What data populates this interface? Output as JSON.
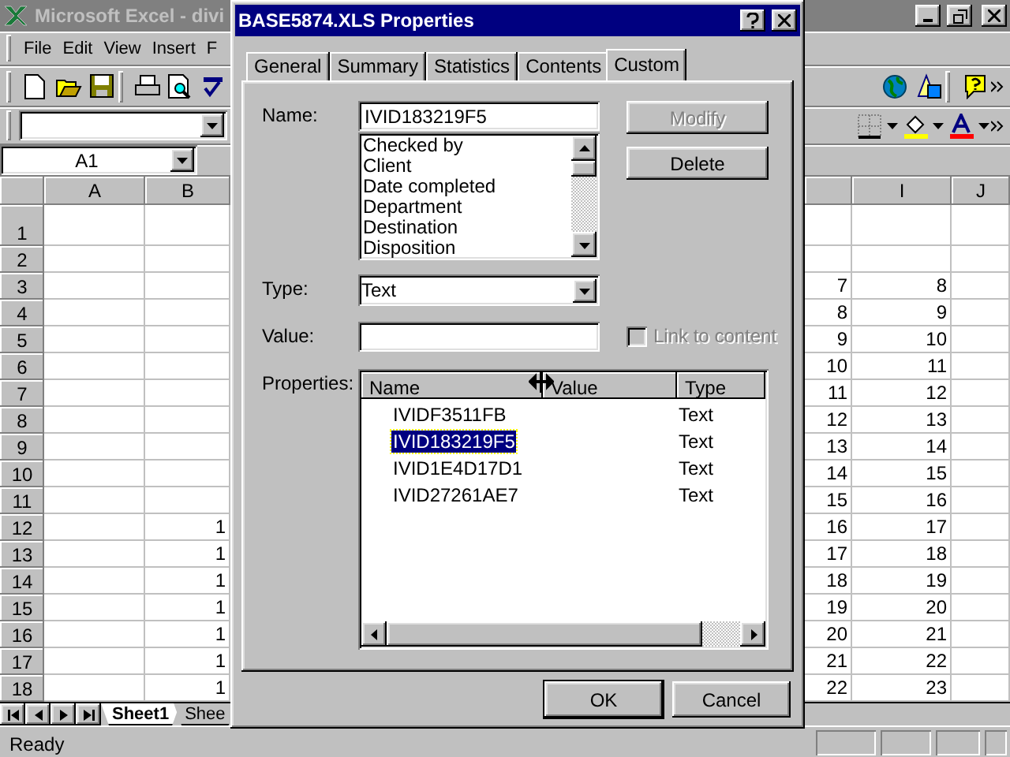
{
  "excel": {
    "title": "Microsoft Excel - divi",
    "menu": [
      "File",
      "Edit",
      "View",
      "Insert",
      "F"
    ],
    "name_box": "A1",
    "headers_left": [
      "A",
      "B"
    ],
    "headers_right": [
      "I",
      "J"
    ],
    "rows": [
      {
        "label": "1"
      },
      {
        "label": "2"
      },
      {
        "label": "3",
        "h": "7",
        "i": "8"
      },
      {
        "label": "4",
        "h": "8",
        "i": "9"
      },
      {
        "label": "5",
        "h": "9",
        "i": "10"
      },
      {
        "label": "6",
        "h": "10",
        "i": "11"
      },
      {
        "label": "7",
        "h": "11",
        "i": "12"
      },
      {
        "label": "8",
        "h": "12",
        "i": "13"
      },
      {
        "label": "9",
        "h": "13",
        "i": "14"
      },
      {
        "label": "10",
        "h": "14",
        "i": "15"
      },
      {
        "label": "11",
        "h": "15",
        "i": "16"
      },
      {
        "label": "12",
        "b": "1",
        "h": "16",
        "i": "17"
      },
      {
        "label": "13",
        "b": "1",
        "h": "17",
        "i": "18"
      },
      {
        "label": "14",
        "b": "1",
        "h": "18",
        "i": "19"
      },
      {
        "label": "15",
        "b": "1",
        "h": "19",
        "i": "20"
      },
      {
        "label": "16",
        "b": "1",
        "h": "20",
        "i": "21"
      },
      {
        "label": "17",
        "b": "1",
        "h": "21",
        "i": "22"
      },
      {
        "label": "18",
        "b": "1",
        "h": "22",
        "i": "23"
      }
    ],
    "sheet_tabs": [
      {
        "label": "Sheet1",
        "selected": true
      },
      {
        "label": "Shee",
        "selected": false
      }
    ],
    "status": "Ready"
  },
  "dialog": {
    "title": "BASE5874.XLS Properties",
    "tabs": [
      {
        "label": "General",
        "selected": false
      },
      {
        "label": "Summary",
        "selected": false
      },
      {
        "label": "Statistics",
        "selected": false
      },
      {
        "label": "Contents",
        "selected": false
      },
      {
        "label": "Custom",
        "selected": true
      }
    ],
    "name_label": "Name:",
    "name_value": "IVID183219F5",
    "name_list": [
      "Checked by",
      "Client",
      "Date completed",
      "Department",
      "Destination",
      "Disposition"
    ],
    "buttons": [
      {
        "label": "Modify",
        "disabled": true
      },
      {
        "label": "Delete",
        "disabled": false
      }
    ],
    "type_label": "Type:",
    "type_value": "Text",
    "value_label": "Value:",
    "link": {
      "label": "Link to content",
      "checked": false,
      "disabled": true
    },
    "properties_label": "Properties:",
    "columns": [
      "Name",
      "Value",
      "Type"
    ],
    "properties": [
      {
        "name": "IVIDF3511FB",
        "type": "Text",
        "selected": false
      },
      {
        "name": "IVID183219F5",
        "type": "Text",
        "selected": true
      },
      {
        "name": "IVID1E4D17D1",
        "type": "Text",
        "selected": false
      },
      {
        "name": "IVID27261AE7",
        "type": "Text",
        "selected": false
      }
    ],
    "ok": "OK",
    "cancel": "Cancel"
  }
}
